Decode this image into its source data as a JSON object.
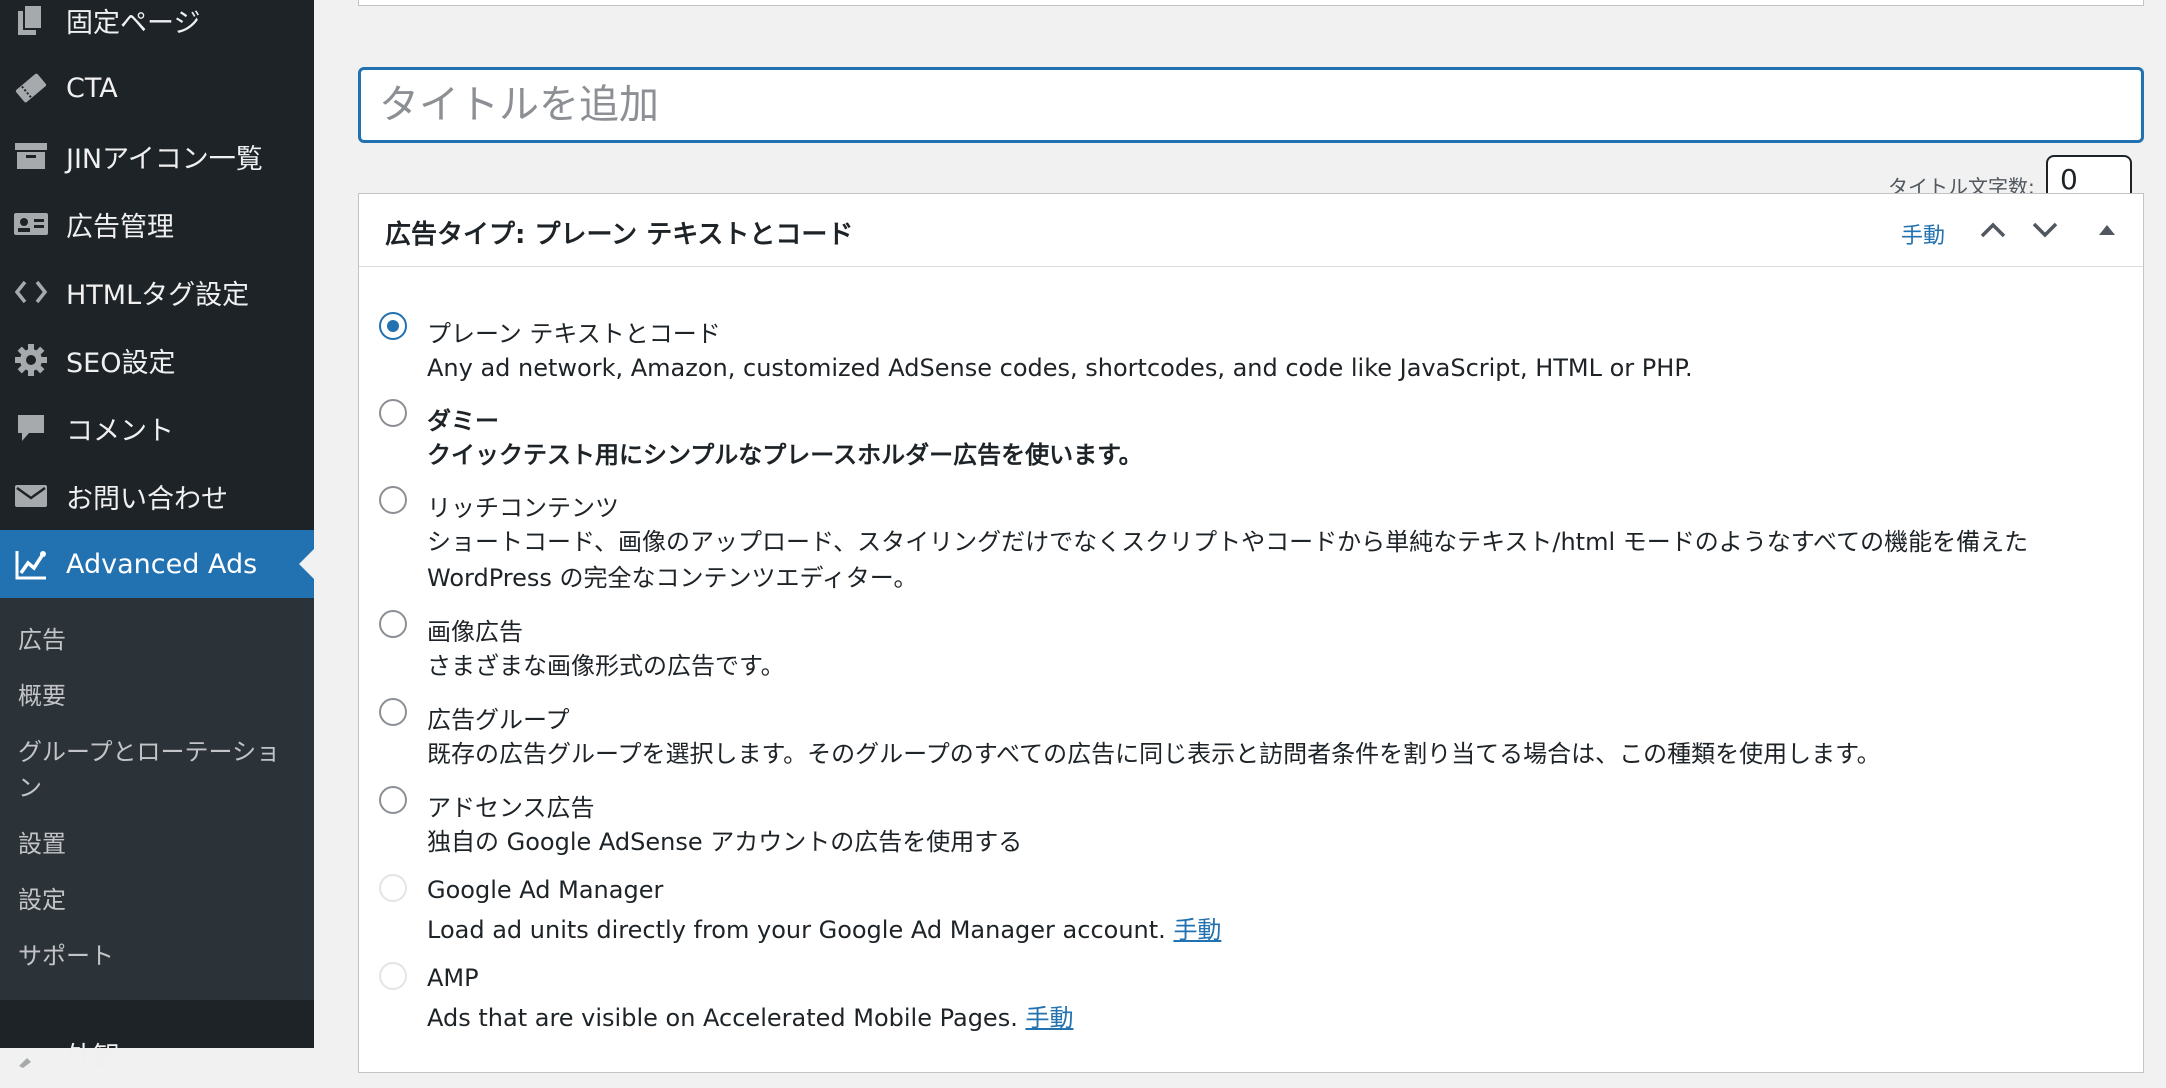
{
  "sidebar": {
    "items": [
      {
        "label": "固定ページ",
        "icon": "page-icon"
      },
      {
        "label": "CTA",
        "icon": "ticket-icon"
      },
      {
        "label": "JINアイコン一覧",
        "icon": "archive-icon"
      },
      {
        "label": "広告管理",
        "icon": "id-card-icon"
      },
      {
        "label": "HTMLタグ設定",
        "icon": "code-icon"
      },
      {
        "label": "SEO設定",
        "icon": "gear-icon"
      },
      {
        "label": "コメント",
        "icon": "comment-icon"
      },
      {
        "label": "お問い合わせ",
        "icon": "mail-icon"
      },
      {
        "label": "Advanced Ads",
        "icon": "chart-icon"
      }
    ],
    "submenu": [
      "広告",
      "概要",
      "グループとローテーション",
      "設置",
      "設定",
      "サポート"
    ],
    "next_item": "外観"
  },
  "title_input": {
    "placeholder": "タイトルを追加",
    "value": ""
  },
  "title_count": {
    "label": "タイトル文字数:",
    "value": "0"
  },
  "panel": {
    "title": "広告タイプ: プレーン テキストとコード",
    "manual_link": "手動",
    "options": [
      {
        "label": "プレーン テキストとコード",
        "desc": "Any ad network, Amazon, customized AdSense codes, shortcodes, and code like JavaScript, HTML or PHP.",
        "state": "checked"
      },
      {
        "label": "ダミー",
        "desc": "クイックテスト用にシンプルなプレースホルダー広告を使います。",
        "state": "unchecked"
      },
      {
        "label": "リッチコンテンツ",
        "desc": "ショートコード、画像のアップロード、スタイリングだけでなくスクリプトやコードから単純なテキスト/html モードのようなすべての機能を備えた WordPress の完全なコンテンツエディター。",
        "state": "unchecked"
      },
      {
        "label": "画像広告",
        "desc": "さまざまな画像形式の広告です。",
        "state": "unchecked"
      },
      {
        "label": "広告グループ",
        "desc": "既存の広告グループを選択します。そのグループのすべての広告に同じ表示と訪問者条件を割り当てる場合は、この種類を使用します。",
        "state": "unchecked"
      },
      {
        "label": "アドセンス広告",
        "desc": "独自の Google AdSense アカウントの広告を使用する",
        "state": "unchecked"
      },
      {
        "label": "Google Ad Manager",
        "desc": "Load ad units directly from your Google Ad Manager account.",
        "link": "手動",
        "state": "disabled"
      },
      {
        "label": "AMP",
        "desc": "Ads that are visible on Accelerated Mobile Pages.",
        "link": "手動",
        "state": "disabled"
      }
    ]
  },
  "colors": {
    "sidebar_bg": "#1d2327",
    "submenu_bg": "#2c3338",
    "accent": "#2271b1",
    "page_bg": "#f1f1f1"
  }
}
